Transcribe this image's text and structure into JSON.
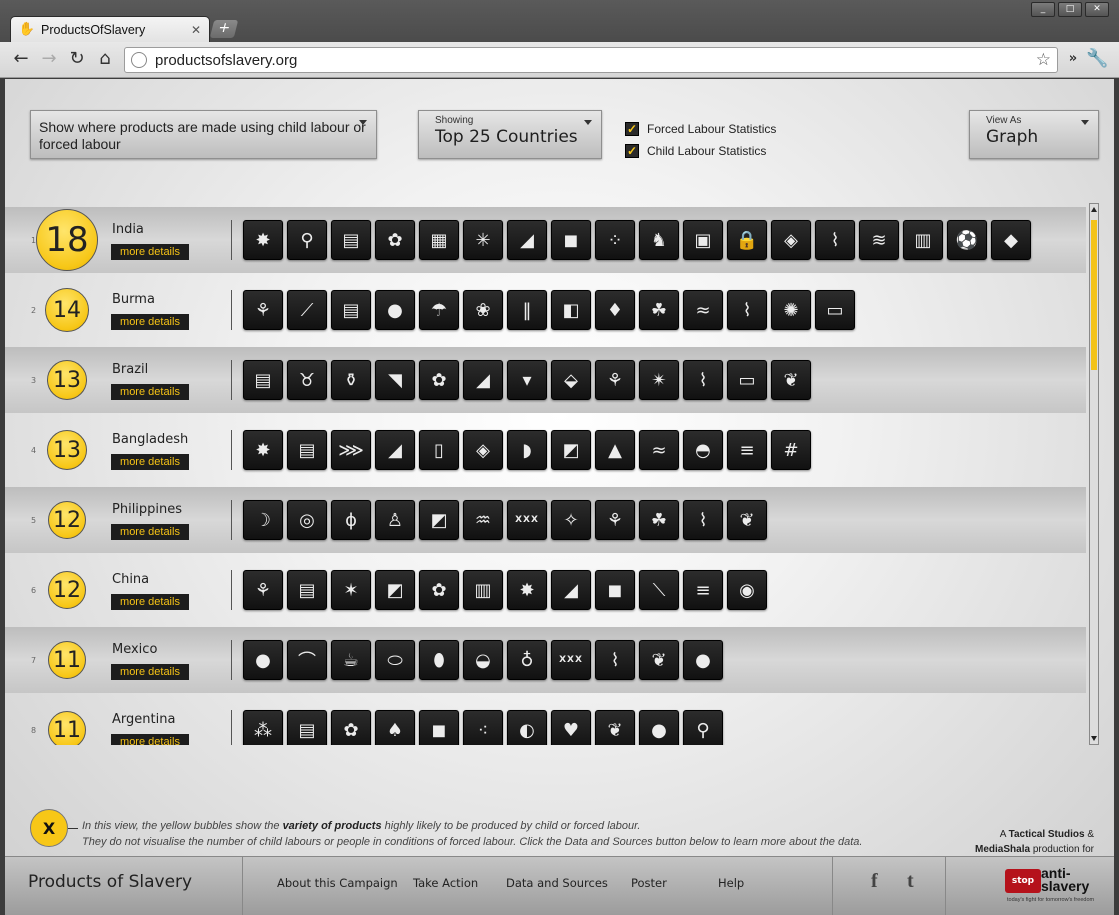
{
  "browser": {
    "tab_title": "ProductsOfSlavery",
    "new_tab": "+",
    "url": "productsofslavery.org",
    "window_controls": [
      "_",
      "□",
      "✕"
    ]
  },
  "controls": {
    "main_dropdown": "Show where products are made using child labour or forced labour",
    "showing_label": "Showing",
    "showing_value": "Top 25 Countries",
    "forced_label": "Forced Labour Statistics",
    "forced_checked": true,
    "child_label": "Child Labour Statistics",
    "child_checked": true,
    "view_label": "View As",
    "view_value": "Graph"
  },
  "more_label": "more details",
  "countries": [
    {
      "rank": "1",
      "name": "India",
      "count": "18",
      "icons": [
        "fireworks",
        "faucet",
        "bricks",
        "cotton",
        "carpet",
        "fern",
        "shoe",
        "tshirt",
        "stones",
        "goat",
        "briefcase",
        "lock",
        "glass",
        "sugarcane",
        "silk",
        "rug",
        "football",
        "gem"
      ]
    },
    {
      "rank": "2",
      "name": "Burma",
      "count": "14",
      "icons": [
        "rice",
        "cane",
        "bricks",
        "bean",
        "umbrella",
        "flower",
        "bamboo",
        "jade",
        "ruby",
        "rubber",
        "shrimp",
        "sugarcane",
        "sunflower",
        "timber"
      ]
    },
    {
      "rank": "3",
      "name": "Brazil",
      "count": "13",
      "icons": [
        "bricks",
        "cattle",
        "pottery",
        "charcoal",
        "cotton",
        "shoe",
        "carrot",
        "pineapple",
        "rice",
        "sisal",
        "sugarcane",
        "timber",
        "tobacco"
      ]
    },
    {
      "rank": "4",
      "name": "Bangladesh",
      "count": "13",
      "icons": [
        "fireworks",
        "bricks",
        "fish",
        "shoe",
        "furniture",
        "glass",
        "leather",
        "match",
        "salt",
        "shrimp",
        "soap",
        "textile",
        "netting"
      ]
    },
    {
      "rank": "5",
      "name": "Philippines",
      "count": "12",
      "icons": [
        "banana",
        "coconut",
        "corn",
        "fashion",
        "coal",
        "pig",
        "porn",
        "pyrotechnics",
        "rice",
        "rubber",
        "sugarcane",
        "tobacco"
      ]
    },
    {
      "rank": "6",
      "name": "China",
      "count": "12",
      "icons": [
        "artificial-flower",
        "bricks",
        "christmas",
        "coal",
        "cotton",
        "electronics",
        "fireworks",
        "shoe",
        "tshirt",
        "nail",
        "textile",
        "toy"
      ]
    },
    {
      "rank": "7",
      "name": "Mexico",
      "count": "11",
      "icons": [
        "bean",
        "chili",
        "coffee",
        "cucumber",
        "eggplant",
        "melon",
        "onion",
        "porn",
        "sugarcane",
        "tobacco",
        "tomato"
      ]
    },
    {
      "rank": "8",
      "name": "Argentina",
      "count": "11",
      "icons": [
        "blueberry",
        "bricks",
        "cotton",
        "garlic",
        "tshirt",
        "grape",
        "olive",
        "strawberry",
        "tobacco",
        "tomato",
        "yerba"
      ]
    }
  ],
  "icon_glyphs": {
    "fireworks": "✸",
    "faucet": "⚲",
    "bricks": "▤",
    "cotton": "✿",
    "carpet": "▦",
    "fern": "✳",
    "shoe": "◢",
    "tshirt": "◼",
    "stones": "⁘",
    "goat": "♞",
    "briefcase": "▣",
    "lock": "🔒",
    "glass": "◈",
    "sugarcane": "⌇",
    "silk": "≋",
    "rug": "▥",
    "football": "⚽",
    "gem": "◆",
    "rice": "⚘",
    "cane": "⟋",
    "bean": "●",
    "umbrella": "☂",
    "flower": "❀",
    "bamboo": "‖",
    "jade": "◧",
    "ruby": "♦",
    "rubber": "☘",
    "shrimp": "≈",
    "sunflower": "✺",
    "timber": "▭",
    "cattle": "♉",
    "pottery": "⚱",
    "charcoal": "◥",
    "carrot": "▾",
    "pineapple": "⬙",
    "sisal": "✴",
    "tobacco": "❦",
    "fish": "⋙",
    "furniture": "▯",
    "leather": "◗",
    "match": "◩",
    "salt": "▲",
    "soap": "◓",
    "textile": "≡",
    "netting": "#",
    "banana": "☽",
    "coconut": "◎",
    "corn": "ϕ",
    "fashion": "♙",
    "coal": "◩",
    "pig": "♒",
    "porn": "XXX",
    "pyrotechnics": "✧",
    "artificial-flower": "⚘",
    "christmas": "✶",
    "electronics": "▥",
    "nail": "⟍",
    "toy": "◉",
    "chili": "⌒",
    "coffee": "☕",
    "cucumber": "⬭",
    "eggplant": "⬮",
    "melon": "◒",
    "onion": "♁",
    "tomato": "●",
    "blueberry": "⁂",
    "garlic": "♠",
    "grape": "⁖",
    "olive": "◐",
    "strawberry": "♥",
    "yerba": "⚲"
  },
  "legend": {
    "bubble": "X",
    "line1_pre": "In this view, the yellow bubbles show the ",
    "line1_bold": "variety of products",
    "line1_post": " highly likely to be produced by child or forced labour.",
    "line2": "They do not visualise the number of child labours or people in conditions of forced labour. Click the Data and Sources button below to learn more about the data."
  },
  "credit": {
    "a": "A ",
    "studio": "Tactical Studios",
    "amp": " &",
    "mediashala": "MediaShala",
    "production": " production for"
  },
  "footer": {
    "title": "Products of Slavery",
    "links": [
      "About this Campaign",
      "Take Action",
      "Data and Sources",
      "Poster",
      "Help"
    ],
    "facebook": "f",
    "twitter": "t",
    "logo_mark": "stop",
    "logo_name": "anti-slavery",
    "logo_tag": "today's fight for tomorrow's freedom"
  },
  "colors": {
    "accent": "#f7c717",
    "dark": "#1d1d1d"
  }
}
